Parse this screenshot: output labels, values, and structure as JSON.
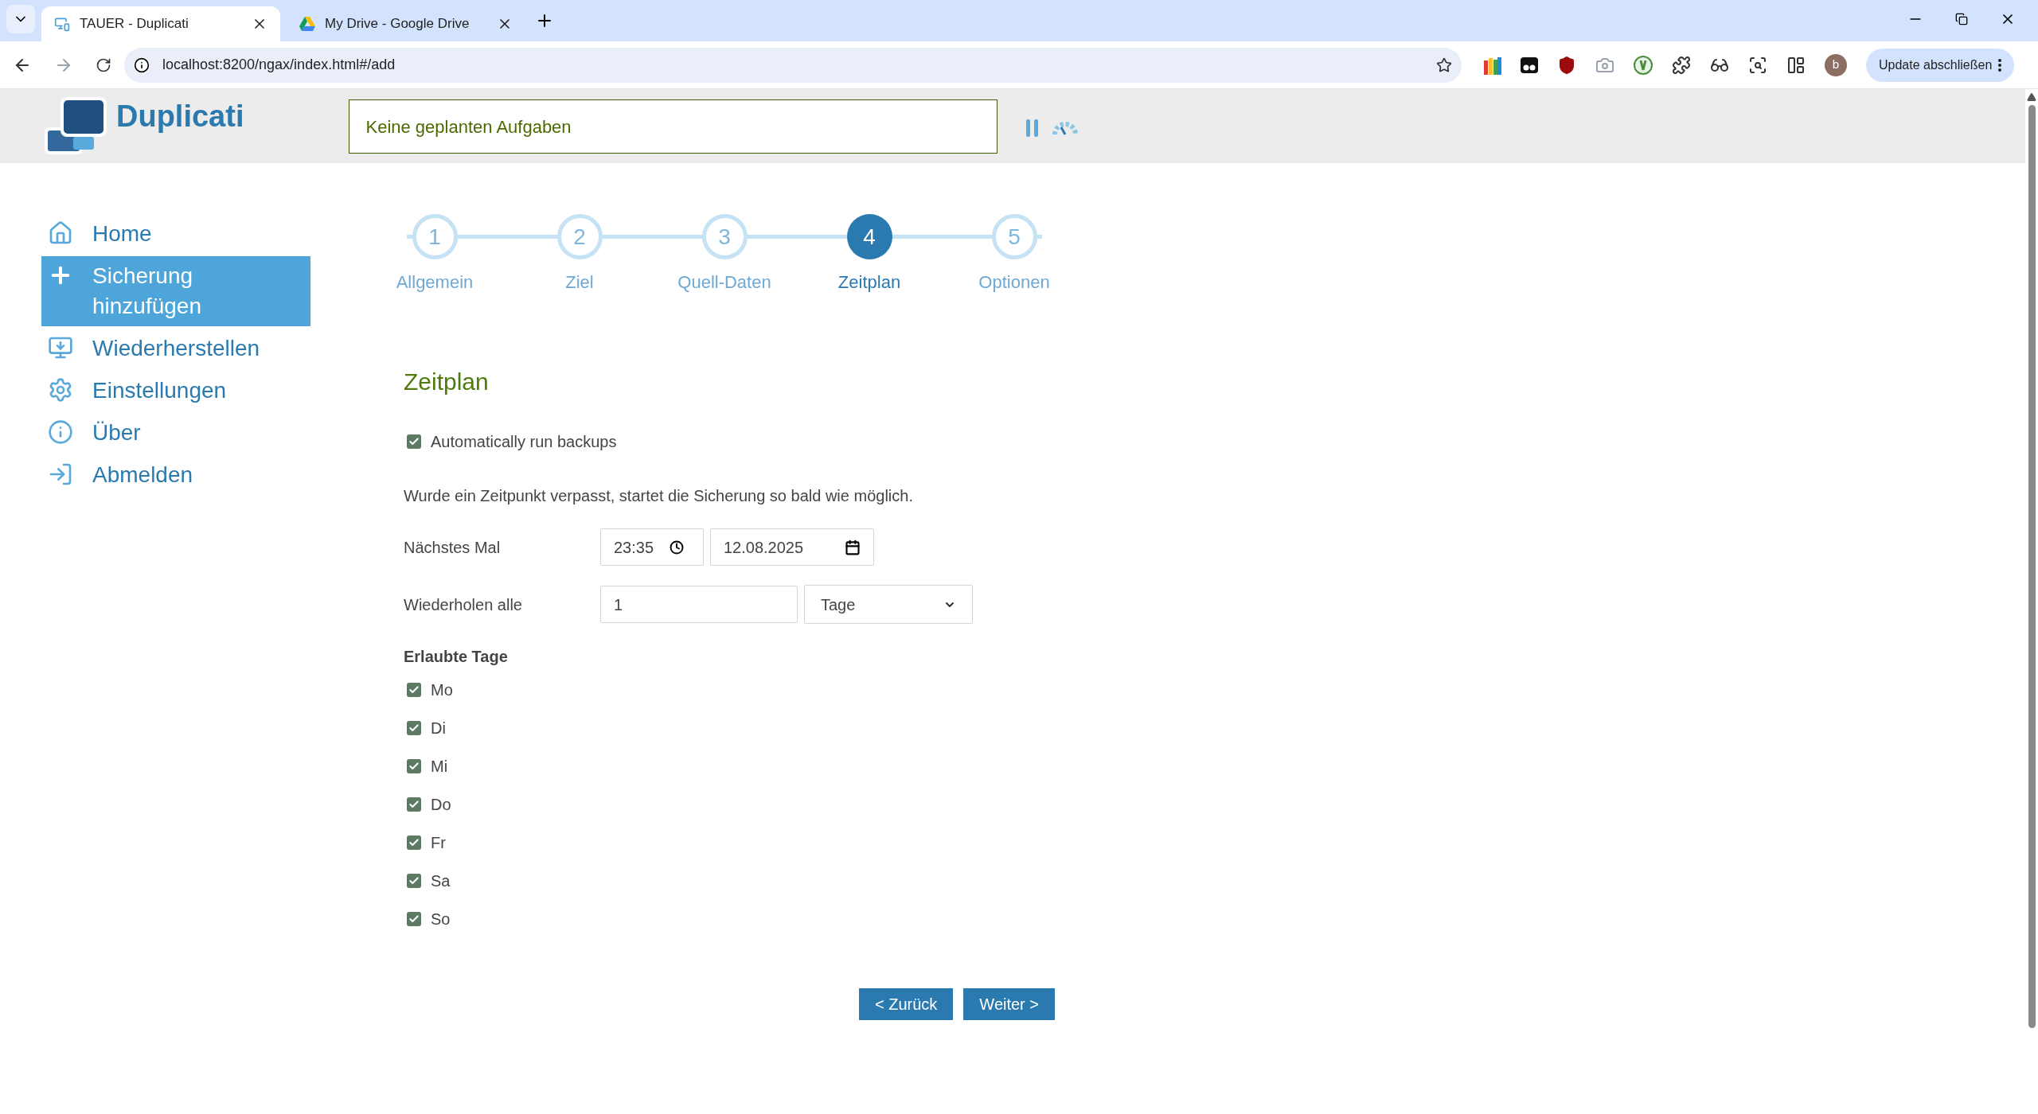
{
  "browser": {
    "tabs": [
      {
        "title": "TAUER - Duplicati",
        "selected": true,
        "kind": "app"
      },
      {
        "title": "My Drive - Google Drive",
        "selected": false,
        "kind": "drive"
      }
    ],
    "address": "localhost:8200/ngax/index.html#/add",
    "profile": "b",
    "update_button": "Update abschließen"
  },
  "header": {
    "logo": "Duplicati",
    "status": "Keine geplanten Aufgaben"
  },
  "sidebar": {
    "items": [
      {
        "label": "Home",
        "kind": "home",
        "selected": false
      },
      {
        "label": "Sicherung hinzufügen",
        "kind": "add",
        "selected": true
      },
      {
        "label": "Wiederherstellen",
        "kind": "restore",
        "selected": false
      },
      {
        "label": "Einstellungen",
        "kind": "settings",
        "selected": false
      },
      {
        "label": "Über",
        "kind": "about",
        "selected": false
      },
      {
        "label": "Abmelden",
        "kind": "logout",
        "selected": false
      }
    ]
  },
  "steps": [
    {
      "number": "1",
      "label": "Allgemein",
      "selected": false
    },
    {
      "number": "2",
      "label": "Ziel",
      "selected": false
    },
    {
      "number": "3",
      "label": "Quell-Daten",
      "selected": false
    },
    {
      "number": "4",
      "label": "Zeitplan",
      "selected": true
    },
    {
      "number": "5",
      "label": "Optionen",
      "selected": false
    }
  ],
  "schedule": {
    "title": "Zeitplan",
    "auto_run": {
      "label": "Automatically run backups",
      "checked": true
    },
    "note": "Wurde ein Zeitpunkt verpasst, startet die Sicherung so bald wie möglich.",
    "next_time": {
      "label": "Nächstes Mal",
      "time": "23:35",
      "date": "12.08.2025"
    },
    "repeat": {
      "label": "Wiederholen alle",
      "value": "1",
      "unit": "Tage"
    },
    "allowed_days": {
      "title": "Erlaubte Tage",
      "days": [
        {
          "label": "Mo",
          "checked": true
        },
        {
          "label": "Di",
          "checked": true
        },
        {
          "label": "Mi",
          "checked": true
        },
        {
          "label": "Do",
          "checked": true
        },
        {
          "label": "Fr",
          "checked": true
        },
        {
          "label": "Sa",
          "checked": true
        },
        {
          "label": "So",
          "checked": true
        }
      ]
    }
  },
  "buttons": {
    "back": "< Zurück",
    "next": "Weiter >"
  }
}
